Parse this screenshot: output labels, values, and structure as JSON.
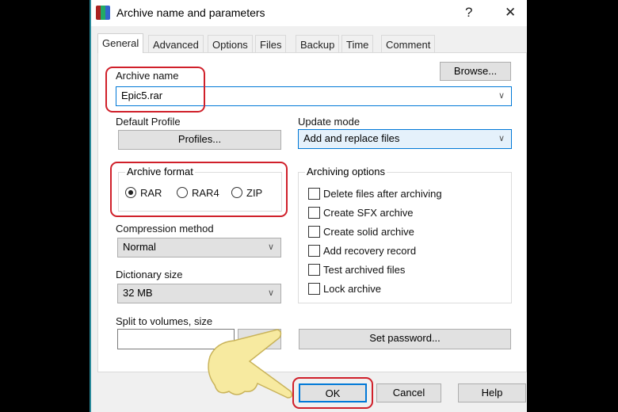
{
  "window": {
    "title": "Archive name and parameters",
    "help": "?",
    "close": "✕"
  },
  "tabs": [
    "General",
    "Advanced",
    "Options",
    "Files",
    "Backup",
    "Time",
    "Comment"
  ],
  "archive_name": {
    "label": "Archive name",
    "value": "Epic5.rar",
    "browse": "Browse..."
  },
  "profile": {
    "label": "Default Profile",
    "button": "Profiles..."
  },
  "update_mode": {
    "label": "Update mode",
    "value": "Add and replace files"
  },
  "archive_format": {
    "label": "Archive format",
    "options": [
      "RAR",
      "RAR4",
      "ZIP"
    ],
    "selected": "RAR"
  },
  "compression": {
    "label": "Compression method",
    "value": "Normal"
  },
  "dictionary": {
    "label": "Dictionary size",
    "value": "32 MB"
  },
  "split": {
    "label": "Split to volumes, size",
    "value": ""
  },
  "archiving_options": {
    "label": "Archiving options",
    "items": [
      {
        "label": "Delete files after archiving",
        "checked": false
      },
      {
        "label": "Create SFX archive",
        "checked": false
      },
      {
        "label": "Create solid archive",
        "checked": false
      },
      {
        "label": "Add recovery record",
        "checked": false
      },
      {
        "label": "Test archived files",
        "checked": false
      },
      {
        "label": "Lock archive",
        "checked": false
      }
    ]
  },
  "set_password": "Set password...",
  "footer": {
    "ok": "OK",
    "cancel": "Cancel",
    "help": "Help"
  },
  "colors": {
    "highlight": "#d0202a",
    "focus": "#0078d7"
  }
}
